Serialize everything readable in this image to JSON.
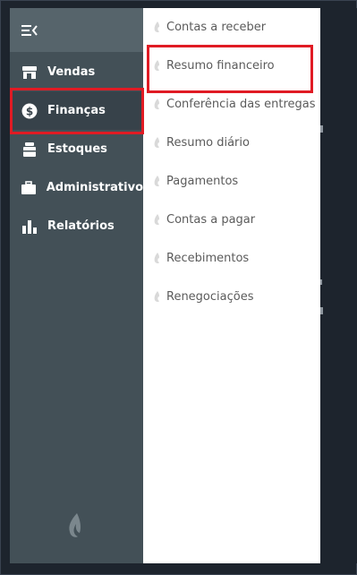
{
  "sidebar": {
    "items": [
      {
        "label": "Vendas",
        "icon": "storefront-icon"
      },
      {
        "label": "Finanças",
        "icon": "dollar-circle-icon",
        "active": true
      },
      {
        "label": "Estoques",
        "icon": "inventory-box-icon"
      },
      {
        "label": "Administrativo",
        "icon": "briefcase-icon"
      },
      {
        "label": "Relatórios",
        "icon": "bar-chart-icon"
      }
    ]
  },
  "submenu": {
    "items": [
      {
        "label": "Contas a receber"
      },
      {
        "label": "Resumo financeiro"
      },
      {
        "label": "Conferência das entregas"
      },
      {
        "label": "Resumo diário"
      },
      {
        "label": "Pagamentos"
      },
      {
        "label": "Contas a pagar"
      },
      {
        "label": "Recebimentos"
      },
      {
        "label": "Renegociações"
      }
    ]
  },
  "colors": {
    "sidebar_bg": "#435057",
    "sidebar_top_bg": "#56646b",
    "active_bg": "#37424a",
    "highlight": "#e01b24",
    "submenu_text": "#5b5b5b"
  }
}
